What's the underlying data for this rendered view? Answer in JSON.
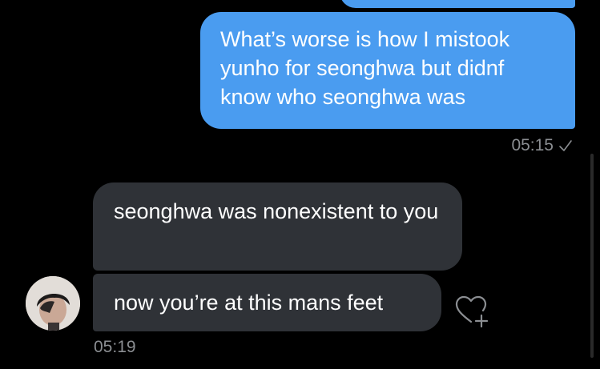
{
  "conversation": {
    "sent_message": {
      "text": "What’s worse is how I mistook yunho for seonghwa but didnf know who seonghwa was",
      "time": "05:15"
    },
    "received_messages": [
      {
        "text": "seonghwa was nonexistent to you"
      },
      {
        "text": "now you’re at this mans feet"
      }
    ],
    "received_time": "05:19"
  },
  "icons": {
    "sent_status": "check-icon",
    "like": "heart-plus-icon",
    "avatar": "avatar"
  },
  "colors": {
    "background": "#000000",
    "sent_bubble": "#4a9cf0",
    "received_bubble": "#2f3237",
    "timestamp": "#8b8e92"
  }
}
